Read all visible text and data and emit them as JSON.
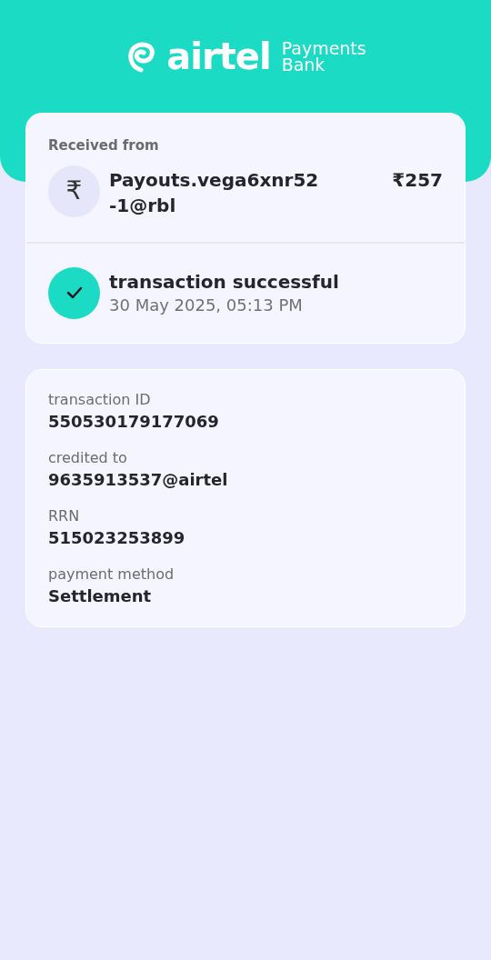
{
  "header": {
    "logo_word": "airtel",
    "logo_line_1": "Payments",
    "logo_line_2": "Bank"
  },
  "payment": {
    "label": "Received from",
    "avatar_symbol": "₹",
    "payer": "Payouts.vega6xnr52\n-1@rbl",
    "amount": "₹257"
  },
  "status": {
    "kind": "success",
    "title": "transaction successful",
    "time": "30 May 2025, 05:13 PM"
  },
  "details": [
    {
      "label": "transaction ID",
      "value": "550530179177069"
    },
    {
      "label": "credited to",
      "value": "9635913537@airtel"
    },
    {
      "label": "RRN",
      "value": "515023253899"
    },
    {
      "label": "payment method",
      "value": "Settlement"
    }
  ]
}
